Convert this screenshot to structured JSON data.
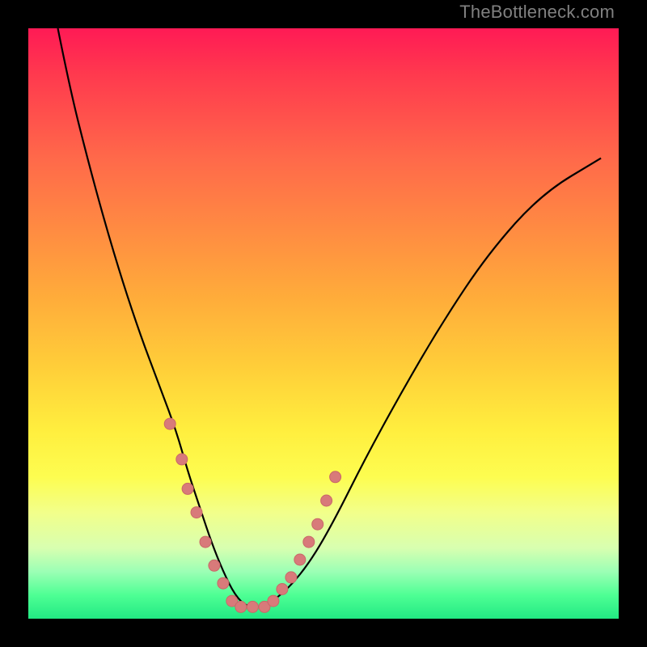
{
  "watermark": {
    "text": "TheBottleneck.com"
  },
  "colors": {
    "background_frame": "#000000",
    "curve_stroke": "#000000",
    "marker_fill": "#d87a7a",
    "marker_stroke": "#c96868",
    "gradient_stops": [
      "#ff1a55",
      "#ff3a4e",
      "#ff694a",
      "#ff8b42",
      "#ffad3a",
      "#ffd039",
      "#ffee3e",
      "#fdfd50",
      "#f2ff8a",
      "#d8ffb0",
      "#9cffb5",
      "#4eff94",
      "#22e983"
    ]
  },
  "chart_data": {
    "type": "line",
    "title": "",
    "xlabel": "",
    "ylabel": "",
    "xlim": [
      0,
      100
    ],
    "ylim": [
      0,
      100
    ],
    "grid": false,
    "legend": false,
    "note": "Axes are unlabeled; values below are normalized 0–100 read from pixel positions (y=0 at bottom, 100 at top).",
    "series": [
      {
        "name": "curve",
        "x": [
          5,
          7,
          10,
          13,
          16,
          19,
          22,
          25,
          27,
          29,
          31,
          33,
          35,
          37,
          40,
          44,
          48,
          52,
          57,
          63,
          70,
          78,
          87,
          97
        ],
        "y": [
          100,
          90,
          78,
          67,
          57,
          48,
          40,
          32,
          25,
          19,
          13,
          8,
          4,
          2,
          2,
          5,
          10,
          17,
          27,
          38,
          50,
          62,
          72,
          78
        ]
      },
      {
        "name": "markers",
        "type": "scatter",
        "x": [
          24,
          26,
          27,
          28.5,
          30,
          31.5,
          33,
          34.5,
          36,
          38,
          40,
          41.5,
          43,
          44.5,
          46,
          47.5,
          49,
          50.5,
          52
        ],
        "y": [
          33,
          27,
          22,
          18,
          13,
          9,
          6,
          3,
          2,
          2,
          2,
          3,
          5,
          7,
          10,
          13,
          16,
          20,
          24
        ]
      }
    ]
  }
}
